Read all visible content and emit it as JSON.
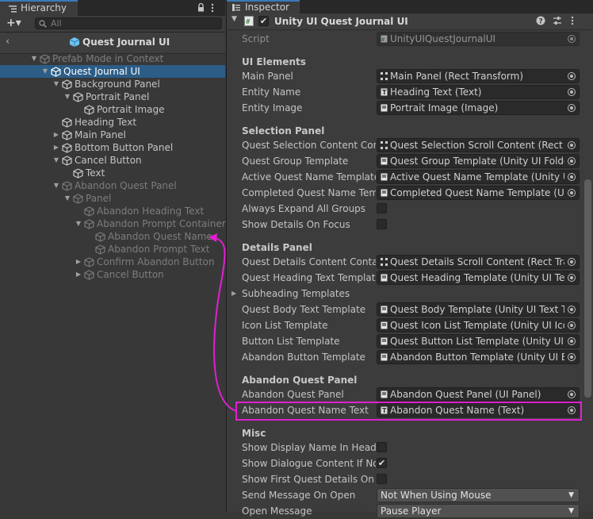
{
  "hierarchy": {
    "tab_label": "Hierarchy",
    "add_label": "+▾",
    "search_placeholder": "All",
    "breadcrumb_title": "Quest Journal UI",
    "rows": [
      {
        "label": "Prefab Mode in Context",
        "indent": 0,
        "arrow": "down",
        "dim": true
      },
      {
        "label": "Quest Journal UI",
        "indent": 1,
        "arrow": "down",
        "selected": true
      },
      {
        "label": "Background Panel",
        "indent": 2,
        "arrow": "down"
      },
      {
        "label": "Portrait Panel",
        "indent": 3,
        "arrow": "down"
      },
      {
        "label": "Portrait Image",
        "indent": 4,
        "arrow": ""
      },
      {
        "label": "Heading Text",
        "indent": 2,
        "arrow": ""
      },
      {
        "label": "Main Panel",
        "indent": 2,
        "arrow": "right"
      },
      {
        "label": "Bottom Button Panel",
        "indent": 2,
        "arrow": "right"
      },
      {
        "label": "Cancel Button",
        "indent": 2,
        "arrow": "down"
      },
      {
        "label": "Text",
        "indent": 3,
        "arrow": ""
      },
      {
        "label": "Abandon Quest Panel",
        "indent": 2,
        "arrow": "down",
        "dim": true
      },
      {
        "label": "Panel",
        "indent": 3,
        "arrow": "down",
        "dim": true
      },
      {
        "label": "Abandon Heading Text",
        "indent": 4,
        "arrow": "",
        "dim": true
      },
      {
        "label": "Abandon Prompt Container",
        "indent": 4,
        "arrow": "down",
        "dim": true
      },
      {
        "label": "Abandon Quest Name",
        "indent": 5,
        "arrow": "",
        "dim": true
      },
      {
        "label": "Abandon Prompt Text",
        "indent": 5,
        "arrow": "",
        "dim": true
      },
      {
        "label": "Confirm Abandon Button",
        "indent": 4,
        "arrow": "right",
        "dim": true
      },
      {
        "label": "Cancel Button",
        "indent": 4,
        "arrow": "right",
        "dim": true
      }
    ]
  },
  "inspector": {
    "tab_label": "Inspector",
    "component_title": "Unity UI Quest Journal UI",
    "script_label": "Script",
    "script_value": "UnityUIQuestJournalUI",
    "sections": {
      "ui_elements": "UI Elements",
      "selection_panel": "Selection Panel",
      "details_panel": "Details Panel",
      "abandon_panel": "Abandon Quest Panel",
      "misc": "Misc"
    },
    "props": {
      "main_panel": {
        "label": "Main Panel",
        "value": "Main Panel (Rect Transform)"
      },
      "entity_name": {
        "label": "Entity Name",
        "value": "Heading Text (Text)"
      },
      "entity_image": {
        "label": "Entity Image",
        "value": "Portrait Image (Image)"
      },
      "qs_content": {
        "label": "Quest Selection Content Cont",
        "value": "Quest Selection Scroll Content (Rect Tra"
      },
      "qg_template": {
        "label": "Quest Group Template",
        "value": "Quest Group Template (Unity UI Foldout"
      },
      "aqn_template": {
        "label": "Active Quest Name Template",
        "value": "Active Quest Name Template (Unity UI C"
      },
      "cqn_template": {
        "label": "Completed Quest Name Temp",
        "value": "Completed Quest Name Template (Unity"
      },
      "always_expand": {
        "label": "Always Expand All Groups"
      },
      "show_details_focus": {
        "label": "Show Details On Focus"
      },
      "qd_content": {
        "label": "Quest Details Content Contair",
        "value": "Quest Details Scroll Content (Rect Trans"
      },
      "qh_template": {
        "label": "Quest Heading Text Template",
        "value": "Quest Heading Template (Unity UI Text"
      },
      "subheading": {
        "label": "Subheading Templates"
      },
      "qb_template": {
        "label": "Quest Body Text Template",
        "value": "Quest Body Template (Unity UI Text Ter"
      },
      "icon_list": {
        "label": "Icon List Template",
        "value": "Quest Icon List Template (Unity UI Icon"
      },
      "button_list": {
        "label": "Button List Template",
        "value": "Quest Button List Template (Unity UI Bu"
      },
      "abandon_button": {
        "label": "Abandon Button Template",
        "value": "Abandon Button Template (Unity UI Butt"
      },
      "abandon_panel": {
        "label": "Abandon Quest Panel",
        "value": "Abandon Quest Panel (UI Panel)"
      },
      "abandon_name_text": {
        "label": "Abandon Quest Name Text",
        "value": "Abandon Quest Name (Text)"
      },
      "show_display_name": {
        "label": "Show Display Name In Headin"
      },
      "show_dialogue": {
        "label": "Show Dialogue Content If No J"
      },
      "show_first_quest": {
        "label": "Show First Quest Details On O"
      },
      "send_message": {
        "label": "Send Message On Open",
        "value": "Not When Using Mouse"
      },
      "open_message": {
        "label": "Open Message",
        "value": "Pause Player"
      }
    },
    "checks": {
      "always_expand": "",
      "show_details_focus": "",
      "show_display_name": "",
      "show_dialogue": "✔",
      "show_first_quest": ""
    }
  },
  "colors": {
    "selection": "#2c5d87",
    "highlight_box": "#e020d0",
    "annotation_arrow": "#e020d0",
    "accent_tab": "#3a79bb"
  },
  "icons": [
    "hierarchy-icon",
    "lock-icon",
    "kebab-menu-icon",
    "search-icon",
    "back-arrow-icon",
    "cube-icon",
    "inspector-icon",
    "script-icon",
    "help-icon",
    "preset-icon",
    "object-picker-icon",
    "rect-transform-icon",
    "text-icon",
    "image-icon",
    "checkmark-icon",
    "dropdown-arrow-icon"
  ]
}
